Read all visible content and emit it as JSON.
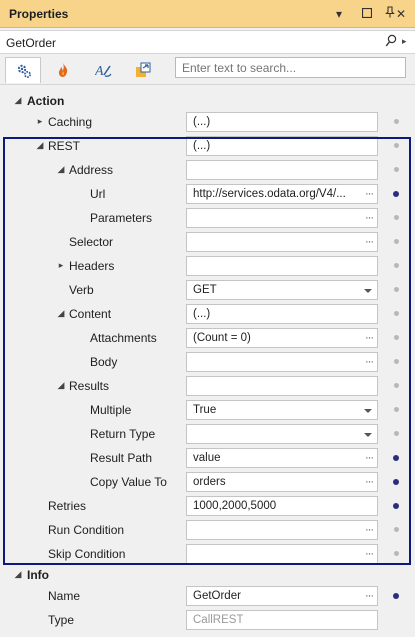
{
  "titlebar": {
    "title": "Properties"
  },
  "objbar": {
    "name": "GetOrder"
  },
  "search": {
    "placeholder": "Enter text to search..."
  },
  "rows": {
    "action": {
      "label": "Action"
    },
    "caching": {
      "label": "Caching",
      "value": "(...)"
    },
    "rest": {
      "label": "REST",
      "value": "(...)"
    },
    "address": {
      "label": "Address",
      "value": ""
    },
    "url": {
      "label": "Url",
      "value": "http://services.odata.org/V4/..."
    },
    "parameters": {
      "label": "Parameters",
      "value": ""
    },
    "selector": {
      "label": "Selector",
      "value": ""
    },
    "headers": {
      "label": "Headers",
      "value": ""
    },
    "verb": {
      "label": "Verb",
      "value": "GET"
    },
    "content": {
      "label": "Content",
      "value": "(...)"
    },
    "attachments": {
      "label": "Attachments",
      "value": "(Count = 0)"
    },
    "body": {
      "label": "Body",
      "value": ""
    },
    "results": {
      "label": "Results",
      "value": ""
    },
    "multiple": {
      "label": "Multiple",
      "value": "True"
    },
    "returntype": {
      "label": "Return Type",
      "value": ""
    },
    "resultpath": {
      "label": "Result Path",
      "value": "value"
    },
    "copyvalueto": {
      "label": "Copy Value To",
      "value": "orders"
    },
    "retries": {
      "label": "Retries",
      "value": "1000,2000,5000"
    },
    "runcondition": {
      "label": "Run Condition",
      "value": ""
    },
    "skipcondition": {
      "label": "Skip Condition",
      "value": ""
    },
    "info": {
      "label": "Info"
    },
    "name": {
      "label": "Name",
      "value": "GetOrder"
    },
    "type": {
      "label": "Type",
      "value": "CallREST"
    }
  }
}
